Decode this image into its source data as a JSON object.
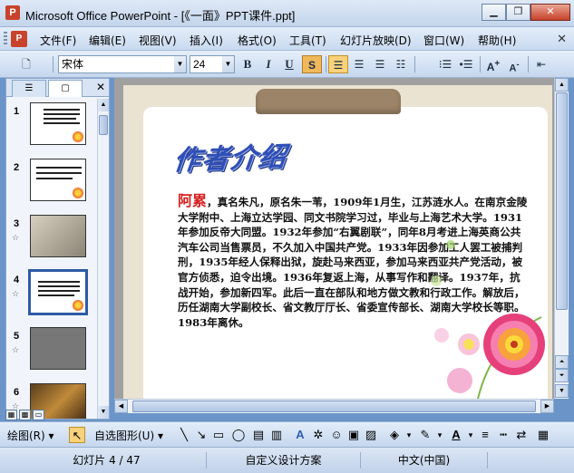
{
  "window": {
    "title": "Microsoft Office PowerPoint - [《一面》PPT课件.ppt]",
    "app_icon": "P"
  },
  "menu": {
    "items": [
      "文件(F)",
      "编辑(E)",
      "视图(V)",
      "插入(I)",
      "格式(O)",
      "工具(T)",
      "幻灯片放映(D)",
      "窗口(W)",
      "帮助(H)"
    ]
  },
  "toolbar": {
    "font_name": "宋体",
    "font_size": "24",
    "bold": "B",
    "italic": "I",
    "underline": "U",
    "shadow": "S"
  },
  "thumbnails": [
    {
      "number": "1",
      "star": ""
    },
    {
      "number": "2",
      "star": ""
    },
    {
      "number": "3",
      "star": "☆"
    },
    {
      "number": "4",
      "star": "☆"
    },
    {
      "number": "5",
      "star": "☆"
    },
    {
      "number": "6",
      "star": "☆"
    }
  ],
  "slide": {
    "heading": "作者介绍",
    "name": "阿累",
    "body": "，真名朱凡，原名朱一苇，1909年1月生，江苏涟水人。在南京金陵大学附中、上海立达学园、同文书院学习过，毕业与上海艺术大学。1931年参加反帝大同盟。1932年参加“右翼剧联”，同年8月考进上海英商公共汽车公司当售票员，不久加入中国共产党。1933年因参加工人罢工被捕判刑，1935年经人保释出狱，旋赴马来西亚，参加马来西亚共产党活动，被官方侦悉，迫令出境。1936年复返上海，从事写作和翻译。1937年，抗战开始，参加新四军。此后一直在部队和地方做文教和行政工作。解放后，历任湖南大学副校长、省文教厅厅长、省委宣传部长、湖南大学校长等职。1983年离休。"
  },
  "drawbar": {
    "draw_label": "绘图(R)",
    "autoshape_label": "自选图形(U)"
  },
  "status": {
    "slide_pos": "幻灯片 4 / 47",
    "design": "自定义设计方案",
    "language": "中文(中国)"
  }
}
